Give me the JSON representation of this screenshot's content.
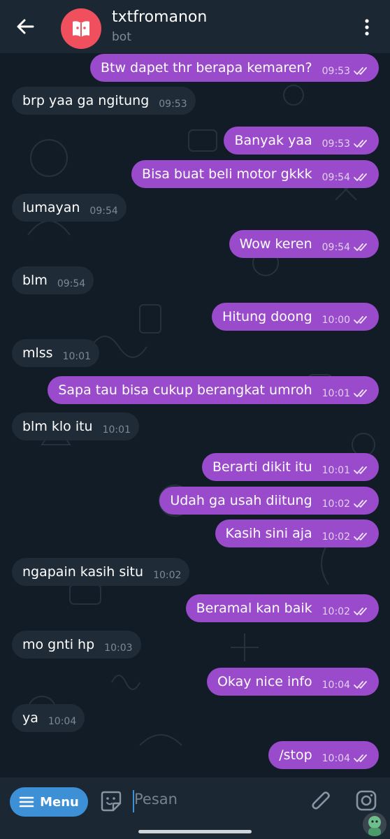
{
  "header": {
    "title": "txtfromanon",
    "subtitle": "bot"
  },
  "messages": [
    {
      "dir": "out",
      "text": "Btw dapet thr berapa kemaren?",
      "time": "09:53",
      "read": true
    },
    {
      "dir": "in",
      "text": "brp yaa ga ngitung",
      "time": "09:53"
    },
    {
      "dir": "out",
      "text": "Banyak yaa",
      "time": "09:53",
      "read": true
    },
    {
      "dir": "out",
      "text": "Bisa buat beli motor gkkk",
      "time": "09:54",
      "read": true
    },
    {
      "dir": "in",
      "text": "lumayan",
      "time": "09:54"
    },
    {
      "dir": "out",
      "text": "Wow keren",
      "time": "09:54",
      "read": true
    },
    {
      "dir": "in",
      "text": "blm",
      "time": "09:54"
    },
    {
      "dir": "out",
      "text": "Hitung doong",
      "time": "10:00",
      "read": true
    },
    {
      "dir": "in",
      "text": "mlss",
      "time": "10:01"
    },
    {
      "dir": "out",
      "text": "Sapa tau bisa cukup berangkat umroh",
      "time": "10:01",
      "read": true
    },
    {
      "dir": "in",
      "text": "blm klo itu",
      "time": "10:01"
    },
    {
      "dir": "out",
      "text": "Berarti dikit itu",
      "time": "10:01",
      "read": true
    },
    {
      "dir": "out",
      "text": "Udah ga usah diitung",
      "time": "10:02",
      "read": true
    },
    {
      "dir": "out",
      "text": "Kasih sini aja",
      "time": "10:02",
      "read": true
    },
    {
      "dir": "in",
      "text": "ngapain kasih situ",
      "time": "10:02"
    },
    {
      "dir": "out",
      "text": "Beramal kan baik",
      "time": "10:02",
      "read": true
    },
    {
      "dir": "in",
      "text": "mo gnti hp",
      "time": "10:03"
    },
    {
      "dir": "out",
      "text": "Okay nice info",
      "time": "10:04",
      "read": true
    },
    {
      "dir": "in",
      "text": "ya",
      "time": "10:04"
    },
    {
      "dir": "out",
      "text": "/stop",
      "time": "10:04",
      "read": true
    }
  ],
  "input": {
    "menu_label": "Menu",
    "placeholder": "Pesan"
  },
  "colors": {
    "outgoing_bubble": "#9a4bcb",
    "incoming_bubble": "#1f2b37",
    "accent": "#3d8fd6",
    "avatar": "#f0505e"
  },
  "icons": [
    "back-arrow-icon",
    "bot-book-icon",
    "more-vertical-icon",
    "menu-lines-icon",
    "sticker-icon",
    "attach-icon",
    "camera-icon",
    "double-check-icon"
  ]
}
